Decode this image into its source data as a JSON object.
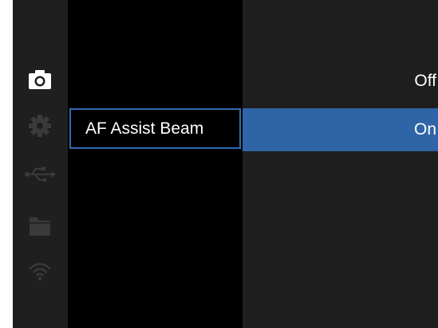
{
  "sidebar": {
    "items": [
      {
        "icon": "camera-icon",
        "active": true
      },
      {
        "icon": "gear-icon",
        "active": false
      },
      {
        "icon": "usb-icon",
        "active": false
      },
      {
        "icon": "folder-icon",
        "active": false
      },
      {
        "icon": "wifi-icon",
        "active": false
      }
    ]
  },
  "menu": {
    "selected_item_label": "AF Assist Beam"
  },
  "options": {
    "off_label": "Off",
    "on_label": "On",
    "selected": "On"
  },
  "colors": {
    "highlight": "#2f64a6",
    "active_icon": "#ffffff",
    "inactive_icon": "#3a3a3a"
  }
}
